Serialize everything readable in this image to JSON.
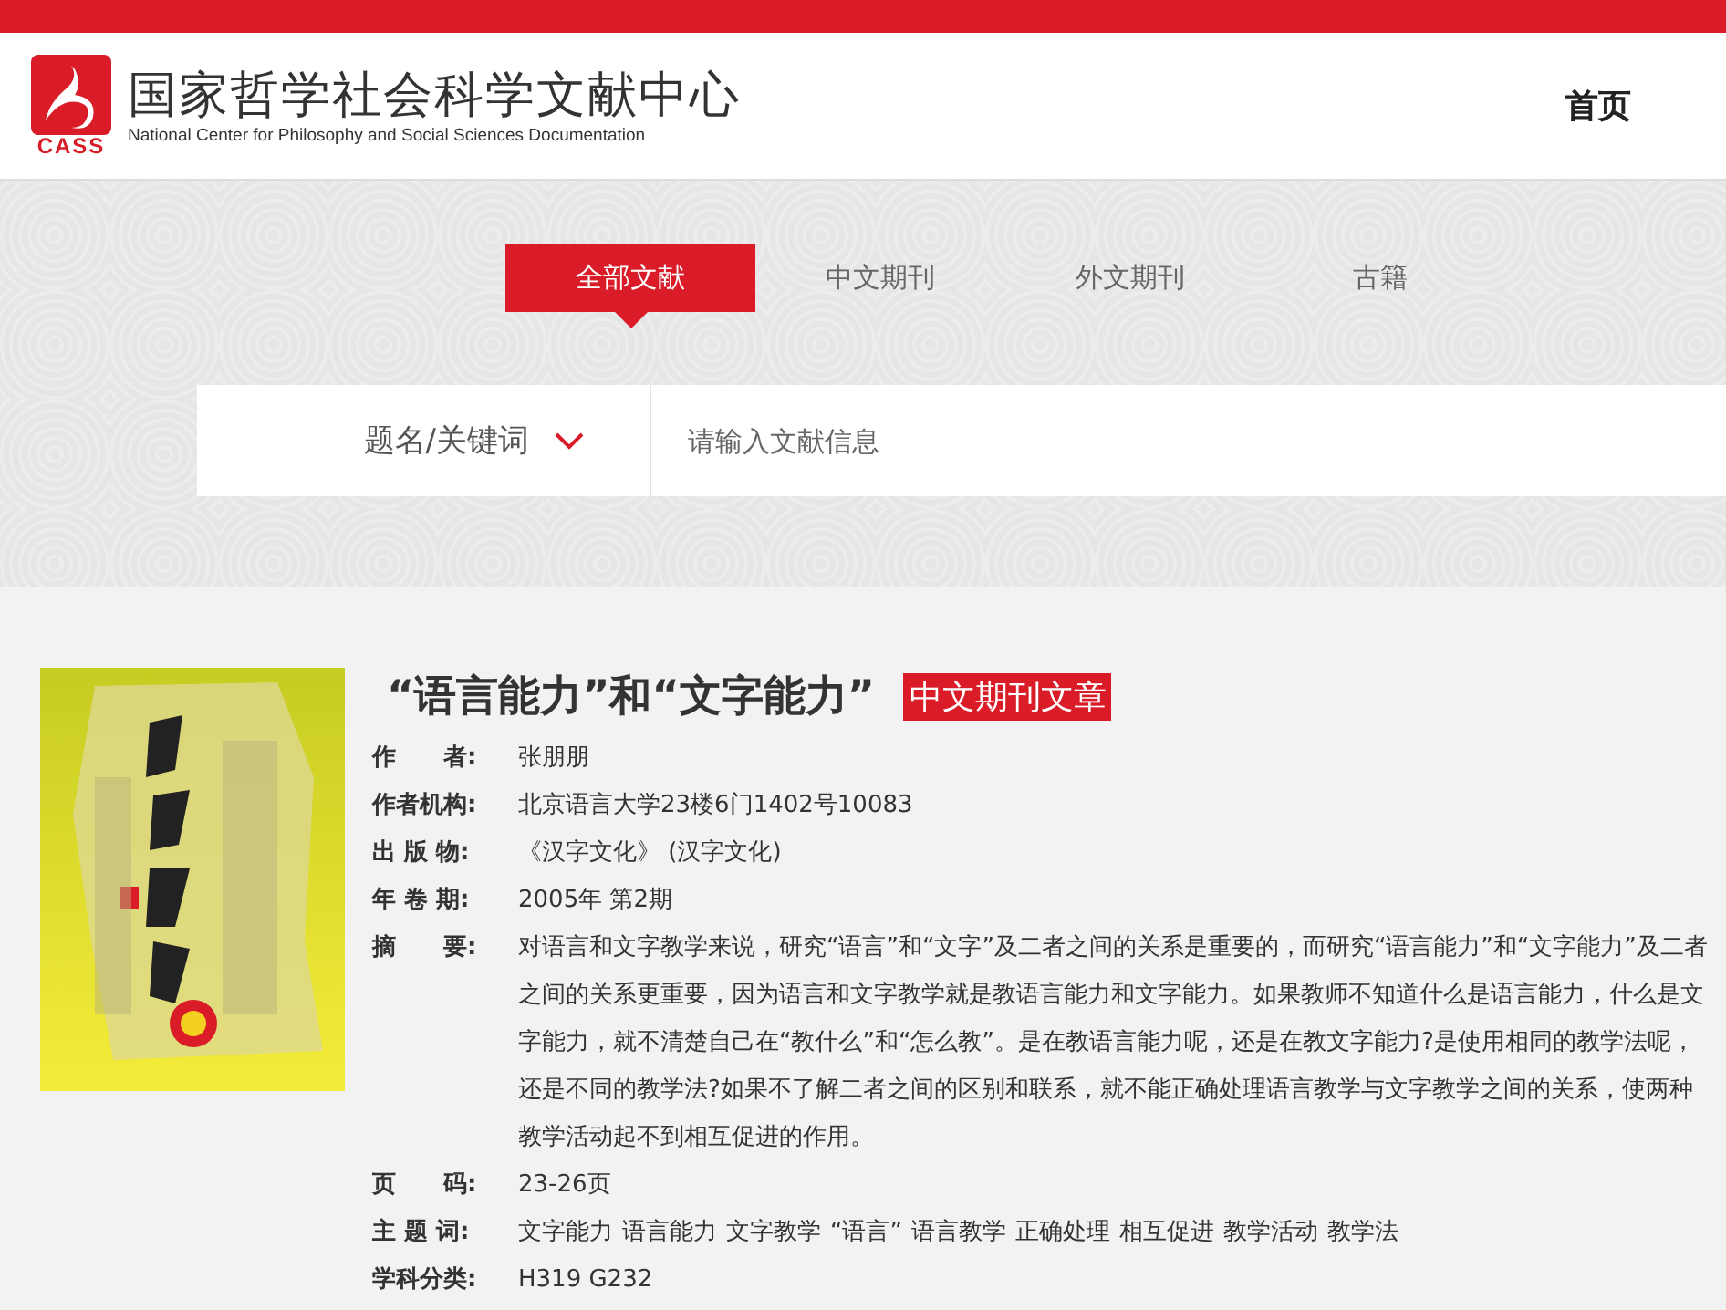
{
  "header": {
    "logo": {
      "mark": "CASS",
      "title": "国家哲学社会科学文献中心",
      "subtitle": "National Center for Philosophy and Social Sciences Documentation"
    },
    "nav": [
      {
        "label": "首页"
      }
    ]
  },
  "tabs": [
    {
      "label": "全部文献",
      "selected": true
    },
    {
      "label": "中文期刊",
      "selected": false
    },
    {
      "label": "外文期刊",
      "selected": false
    },
    {
      "label": "古籍",
      "selected": false
    }
  ],
  "search": {
    "field_selector": "题名/关键词",
    "placeholder": "请输入文献信息"
  },
  "article": {
    "title": "“语言能力”和“文字能力”",
    "type_badge": "中文期刊文章",
    "fields": [
      {
        "kind": "text",
        "label": "作　　者:",
        "value": "张朋朋"
      },
      {
        "kind": "text",
        "label": "作者机构:",
        "value": "北京语言大学23楼6门1402号10083"
      },
      {
        "kind": "text",
        "label": "出 版 物:",
        "value": "《汉字文化》 (汉字文化)"
      },
      {
        "kind": "text",
        "label": "年 卷 期:",
        "value": "2005年 第2期"
      },
      {
        "kind": "text",
        "label": "摘　　要:",
        "value": "对语言和文字教学来说，研究“语言”和“文字”及二者之间的关系是重要的，而研究“语言能力”和“文字能力”及二者之间的关系更重要，因为语言和文字教学就是教语言能力和文字能力。如果教师不知道什么是语言能力，什么是文字能力，就不清楚自己在“教什么”和“怎么教”。是在教语言能力呢，还是在教文字能力?是使用相同的教学法呢，还是不同的教学法?如果不了解二者之间的区别和联系，就不能正确处理语言教学与文字教学之间的关系，使两种教学活动起不到相互促进的作用。"
      },
      {
        "kind": "text",
        "label": "页　　码:",
        "value": "23-26页"
      },
      {
        "kind": "keywords",
        "label": "主 题 词:",
        "values": [
          "文字能力",
          "语言能力",
          "文字教学",
          "“语言”",
          "语言教学",
          "正确处理",
          "相互促进",
          "教学活动",
          "教学法"
        ]
      },
      {
        "kind": "text",
        "label": "学科分类:",
        "value": "H319 G232"
      }
    ]
  }
}
